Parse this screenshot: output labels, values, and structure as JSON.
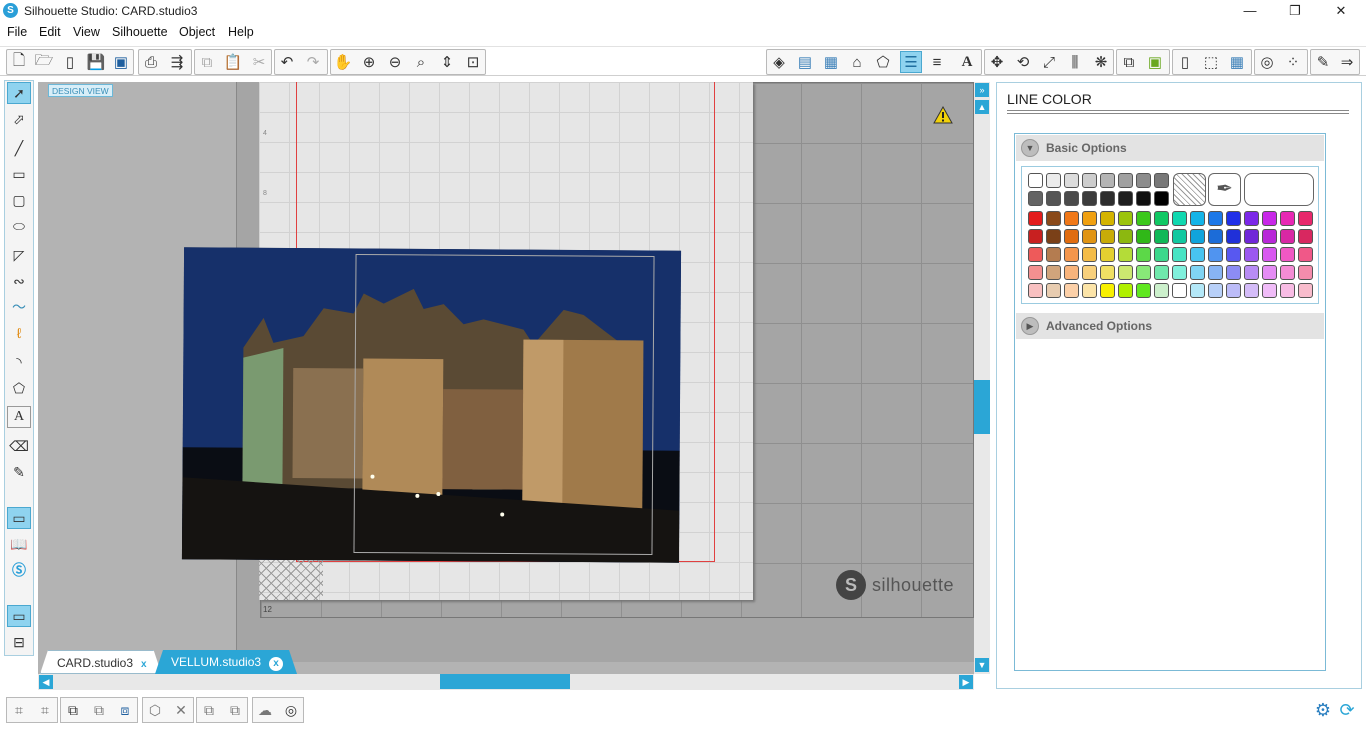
{
  "window": {
    "title": "Silhouette Studio: CARD.studio3",
    "minimize": "—",
    "restore": "❐",
    "close": "✕",
    "logo": "S"
  },
  "menu": [
    "File",
    "Edit",
    "View",
    "Silhouette",
    "Object",
    "Help"
  ],
  "canvas": {
    "design_view_label": "DESIGN VIEW",
    "ruler_4": "4",
    "ruler_8": "8",
    "ruler_12": "12",
    "watermark": "silhouette",
    "watermark_logo": "S"
  },
  "tabs": [
    {
      "label": "CARD.studio3",
      "close": "x"
    },
    {
      "label": "VELLUM.studio3",
      "close": "x"
    }
  ],
  "panel": {
    "title": "LINE COLOR",
    "basic_options": "Basic Options",
    "advanced_options": "Advanced Options",
    "grays": [
      "#ffffff",
      "#ebebeb",
      "#dcdcdc",
      "#cdcdcd",
      "#b4b4b4",
      "#a0a0a0",
      "#8c8c8c",
      "#787878",
      "#646464",
      "#555555",
      "#4b4b4b",
      "#3c3c3c",
      "#2d2d2d",
      "#1e1e1e",
      "#0f0f0f",
      "#000000"
    ],
    "colors": [
      [
        "#e31b1b",
        "#8a4a1a",
        "#f07818",
        "#f0a010",
        "#d4b400",
        "#9cc40c",
        "#3cc81c",
        "#10c864",
        "#10d8b0",
        "#14b4e8",
        "#1c78e8",
        "#2030e8",
        "#7c28e8",
        "#c828e8",
        "#e828b4",
        "#e8286c"
      ],
      [
        "#c82020",
        "#7a4018",
        "#e06c10",
        "#e09414",
        "#c8ac08",
        "#8cb810",
        "#30b818",
        "#10b858",
        "#10c8a0",
        "#10a4dc",
        "#1c6cd8",
        "#2030d8",
        "#7028d8",
        "#b828d8",
        "#d828a4",
        "#d82860"
      ],
      [
        "#ee5a5a",
        "#b47c50",
        "#f4964c",
        "#f4bc48",
        "#e4d030",
        "#b4dc38",
        "#5cd848",
        "#3cd88c",
        "#48e4c4",
        "#48c4f0",
        "#5094f0",
        "#5858f0",
        "#9c58f0",
        "#d858f0",
        "#f058c4",
        "#f05888"
      ],
      [
        "#f49090",
        "#d0a47c",
        "#f8b47c",
        "#f8d07c",
        "#f0e064",
        "#cce870",
        "#88e878",
        "#70e8ac",
        "#80f0dc",
        "#80d4f4",
        "#88b4f4",
        "#8c8cf4",
        "#b88cf4",
        "#e48cf4",
        "#f48cd4",
        "#f48cac"
      ],
      [
        "#f8c0c0",
        "#e8ccb0",
        "#fcd0a8",
        "#fce4a8",
        "#f8f000",
        "#b0f000",
        "#60e820",
        "#ccf0cc",
        "#ffffff",
        "#b4e8f8",
        "#b8d0f8",
        "#bcbcf8",
        "#d4bcf8",
        "#f0bcf8",
        "#f8bce4",
        "#f8bccc"
      ]
    ]
  },
  "colors": {
    "accent": "#2ba6d6",
    "page_border": "#e04040"
  }
}
